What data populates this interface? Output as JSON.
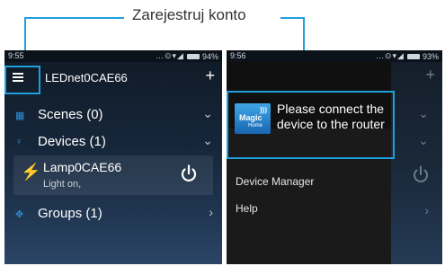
{
  "annotation": {
    "label": "Zarejestruj konto",
    "highlight_color": "#1ea0dc"
  },
  "left_screen": {
    "status": {
      "time": "9:55",
      "battery": "94%"
    },
    "app_bar": {
      "title": "LEDnet0CAE66",
      "add": "+"
    },
    "scenes": {
      "label": "Scenes (0)",
      "icon": "scenes-icon"
    },
    "devices": {
      "label": "Devices (1)",
      "icon": "bulb-icon"
    },
    "device": {
      "name": "Lamp0CAE66",
      "status": "Light on,",
      "icon": "lamp-icon"
    },
    "groups": {
      "label": "Groups (1)",
      "icon": "groups-icon"
    }
  },
  "right_screen": {
    "status": {
      "time": "9:56",
      "battery": "93%"
    },
    "drawer": {
      "logo_text": "Magic",
      "logo_sub": "Home",
      "message": "Please connect the device to the router",
      "items": [
        "Device Manager",
        "Help"
      ]
    },
    "add": "+"
  }
}
